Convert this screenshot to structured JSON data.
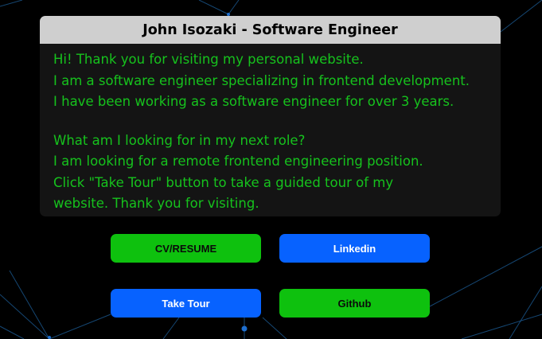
{
  "colors": {
    "background": "#000000",
    "card_background": "#141414",
    "card_header": "#cfcfcf",
    "text_green": "#16c21d",
    "button_green": "#0ec10e",
    "button_blue": "#0762ff",
    "network_lines": "#1d5f9a"
  },
  "card": {
    "title": "John Isozaki - Software Engineer",
    "paragraph1": [
      "Hi! Thank you for visiting my personal website.",
      "I am a software engineer specializing in frontend development.",
      "I have been working as a software engineer for over 3 years."
    ],
    "paragraph2": [
      "What am I looking for in my next role?",
      "I am looking for a remote frontend engineering position.",
      "Click \"Take Tour\" button to take a guided tour of my",
      "website. Thank you for visiting."
    ]
  },
  "buttons": {
    "cv_label": "CV/RESUME",
    "linkedin_label": "Linkedin",
    "tour_label": "Take Tour",
    "github_label": "Github"
  }
}
